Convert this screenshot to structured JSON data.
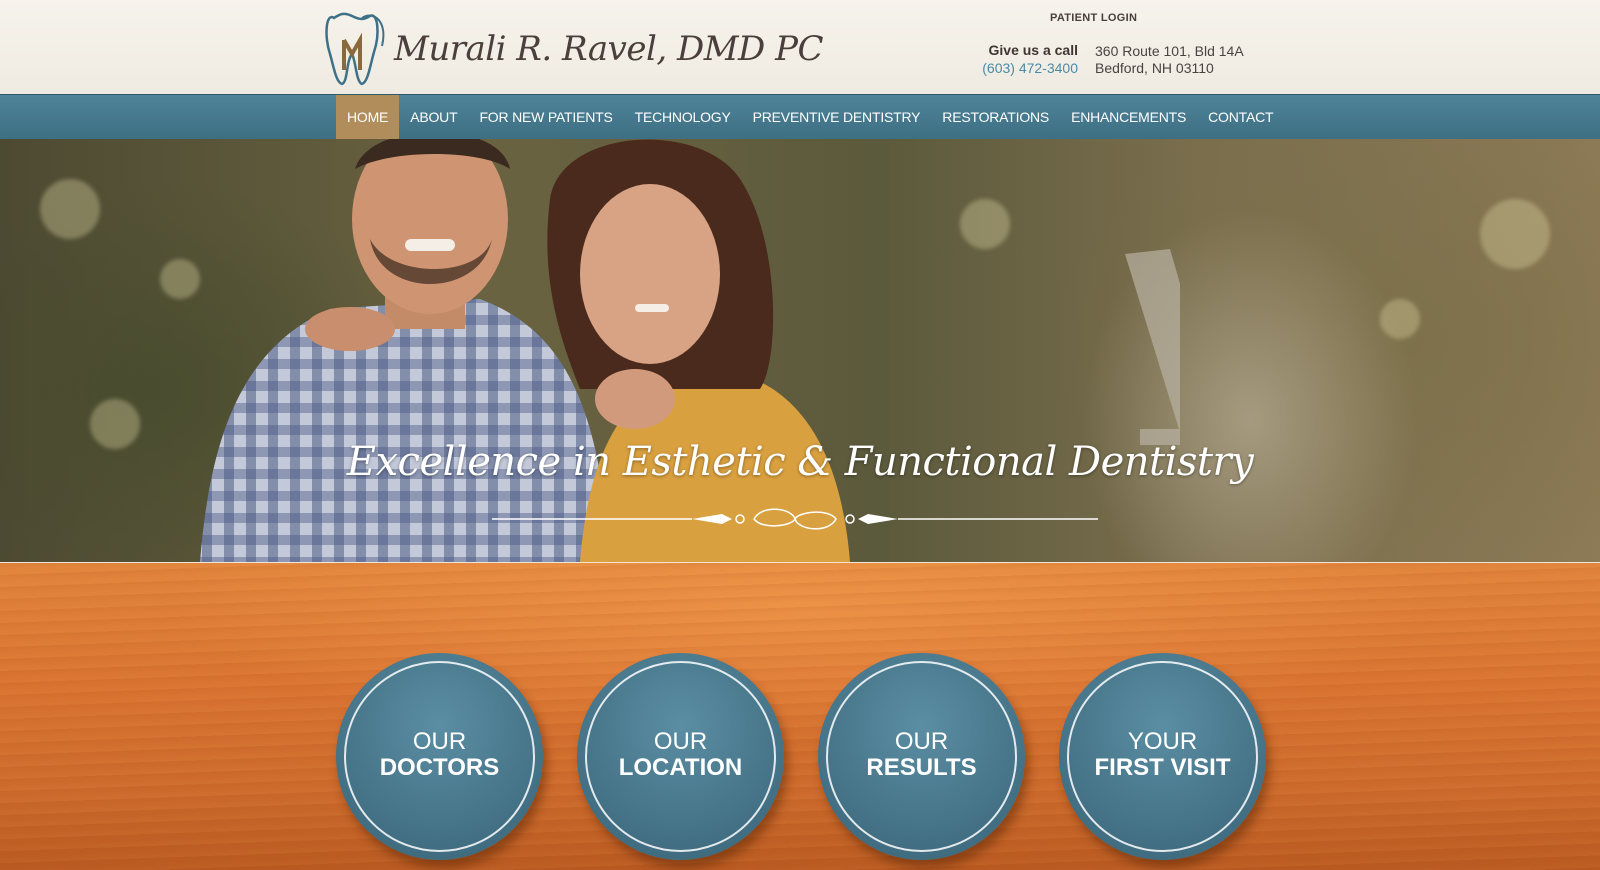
{
  "header": {
    "logo_text": "Murali R. Ravel, DMD PC",
    "patient_login": "PATIENT LOGIN",
    "call_label": "Give us a call",
    "phone": "(603) 472-3400",
    "address_line1": "360 Route 101, Bld 14A",
    "address_line2": "Bedford, NH 03110"
  },
  "nav": {
    "items": [
      {
        "label": "HOME",
        "active": true
      },
      {
        "label": "ABOUT"
      },
      {
        "label": "FOR NEW PATIENTS"
      },
      {
        "label": "TECHNOLOGY"
      },
      {
        "label": "PREVENTIVE DENTISTRY"
      },
      {
        "label": "RESTORATIONS"
      },
      {
        "label": "ENHANCEMENTS"
      },
      {
        "label": "CONTACT"
      }
    ]
  },
  "hero": {
    "tagline": "Excellence in Esthetic & Functional Dentistry"
  },
  "features": [
    {
      "line1": "OUR",
      "line2": "DOCTORS"
    },
    {
      "line1": "OUR",
      "line2": "LOCATION"
    },
    {
      "line1": "OUR",
      "line2": "RESULTS"
    },
    {
      "line1": "YOUR",
      "line2": "FIRST VISIT"
    }
  ],
  "colors": {
    "nav_bg": "#437488",
    "nav_active": "#b08d5b",
    "accent_teal": "#4d8aa3",
    "wood_orange": "#d97332"
  }
}
